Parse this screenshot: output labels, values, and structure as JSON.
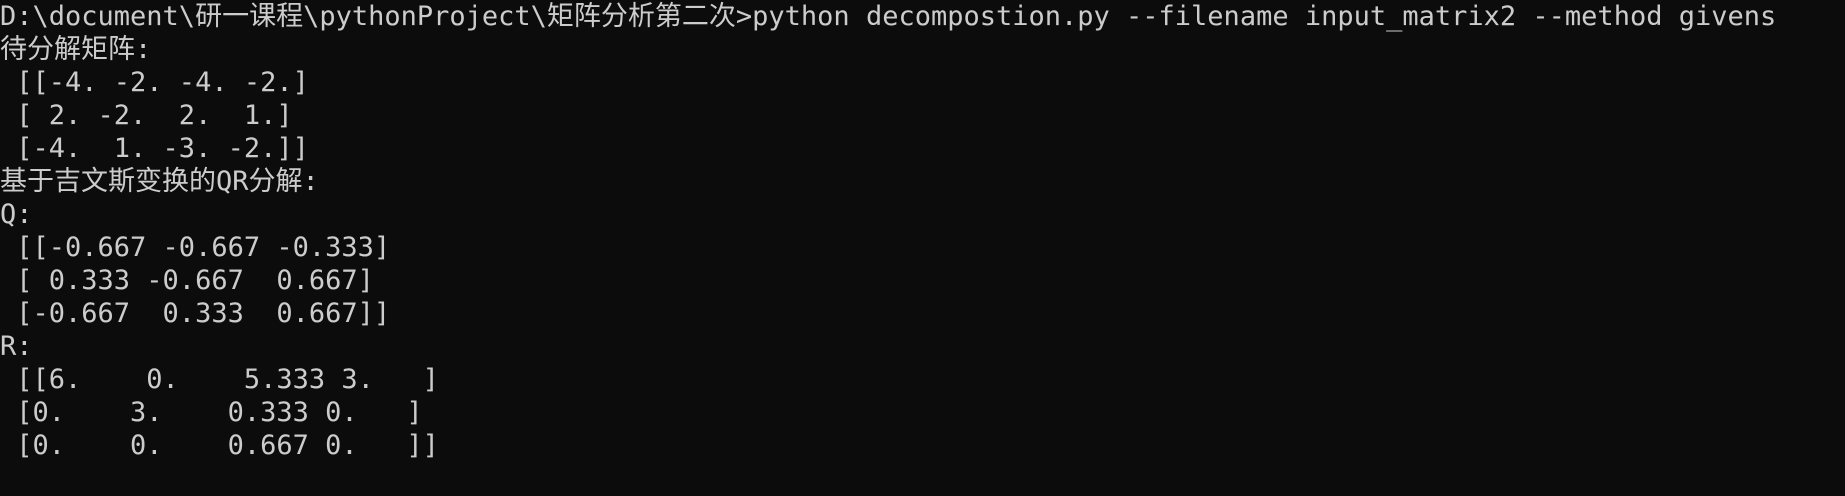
{
  "console": {
    "prompt": {
      "path": "D:\\document\\研一课程\\pythonProject\\矩阵分析第二次>",
      "command": "python decompostion.py --filename input_matrix2 --method givens"
    },
    "output_lines": [
      "待分解矩阵:",
      " [[-4. -2. -4. -2.]",
      " [ 2. -2.  2.  1.]",
      " [-4.  1. -3. -2.]]",
      "基于吉文斯变换的QR分解:",
      "Q:",
      " [[-0.667 -0.667 -0.333]",
      " [ 0.333 -0.667  0.667]",
      " [-0.667  0.333  0.667]]",
      "R:",
      " [[6.    0.    5.333 3.   ]",
      " [0.    3.    0.333 0.   ]",
      " [0.    0.    0.667 0.   ]]"
    ]
  },
  "colors": {
    "background": "#0c0c0c",
    "text": "#cccccc"
  }
}
